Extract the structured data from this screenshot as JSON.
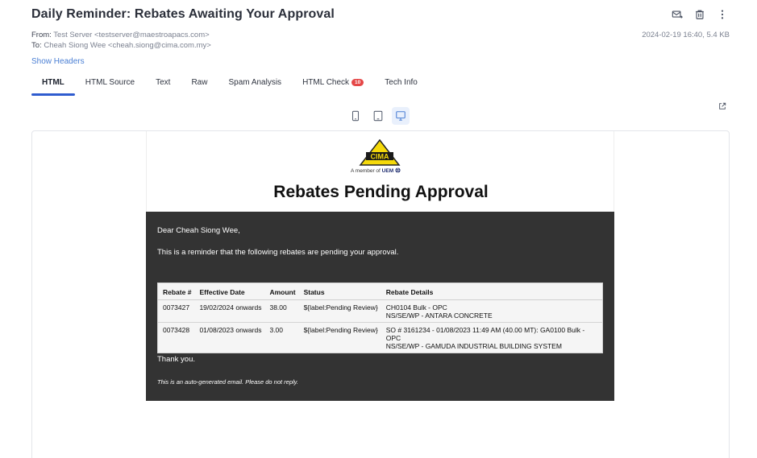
{
  "email": {
    "subject": "Daily Reminder: Rebates Awaiting Your Approval",
    "from_label": "From:",
    "from_value": "Test Server <testserver@maestroapacs.com>",
    "to_label": "To:",
    "to_value": "Cheah Siong Wee <cheah.siong@cima.com.my>",
    "date_size": "2024-02-19 16:40, 5.4 KB",
    "show_headers": "Show Headers"
  },
  "toolbar": {
    "icons": [
      "forward-mail-icon",
      "trash-icon",
      "more-vertical-icon"
    ]
  },
  "tabs": [
    {
      "label": "HTML",
      "active": true
    },
    {
      "label": "HTML Source",
      "active": false
    },
    {
      "label": "Text",
      "active": false
    },
    {
      "label": "Raw",
      "active": false
    },
    {
      "label": "Spam Analysis",
      "active": false
    },
    {
      "label": "HTML Check",
      "active": false,
      "badge": "10"
    },
    {
      "label": "Tech Info",
      "active": false
    }
  ],
  "devices": [
    {
      "name": "mobile",
      "active": false
    },
    {
      "name": "tablet",
      "active": false
    },
    {
      "name": "desktop",
      "active": true
    }
  ],
  "colors": {
    "accent": "#2f5ccf",
    "link": "#4a7fd4",
    "badge": "#e54848",
    "email_body_bg": "#333333",
    "logo_yellow": "#f5d90a"
  },
  "content": {
    "logo_text": "CIMA",
    "member_prefix": "A member of",
    "member_brand": "UEM",
    "title": "Rebates Pending Approval",
    "greeting": "Dear Cheah Siong Wee,",
    "intro": "This is a reminder that the following rebates are pending your approval.",
    "table": {
      "headers": [
        "Rebate #",
        "Effective Date",
        "Amount",
        "Status",
        "Rebate Details"
      ],
      "rows": [
        {
          "rebate": "0073427",
          "date": "19/02/2024 onwards",
          "amount": "38.00",
          "status": "${label:Pending Review}",
          "details_1": "CH0104 Bulk - OPC",
          "details_2": "NS/SE/WP - ANTARA CONCRETE"
        },
        {
          "rebate": "0073428",
          "date": "01/08/2023 onwards",
          "amount": "3.00",
          "status": "${label:Pending Review}",
          "details_1": "SO # 3161234 - 01/08/2023 11:49 AM (40.00 MT): GA0100 Bulk - OPC",
          "details_2": "NS/SE/WP - GAMUDA INDUSTRIAL BUILDING SYSTEM"
        }
      ]
    },
    "thanks": "Thank you.",
    "auto_note": "This is an auto-generated email. Please do not reply."
  }
}
